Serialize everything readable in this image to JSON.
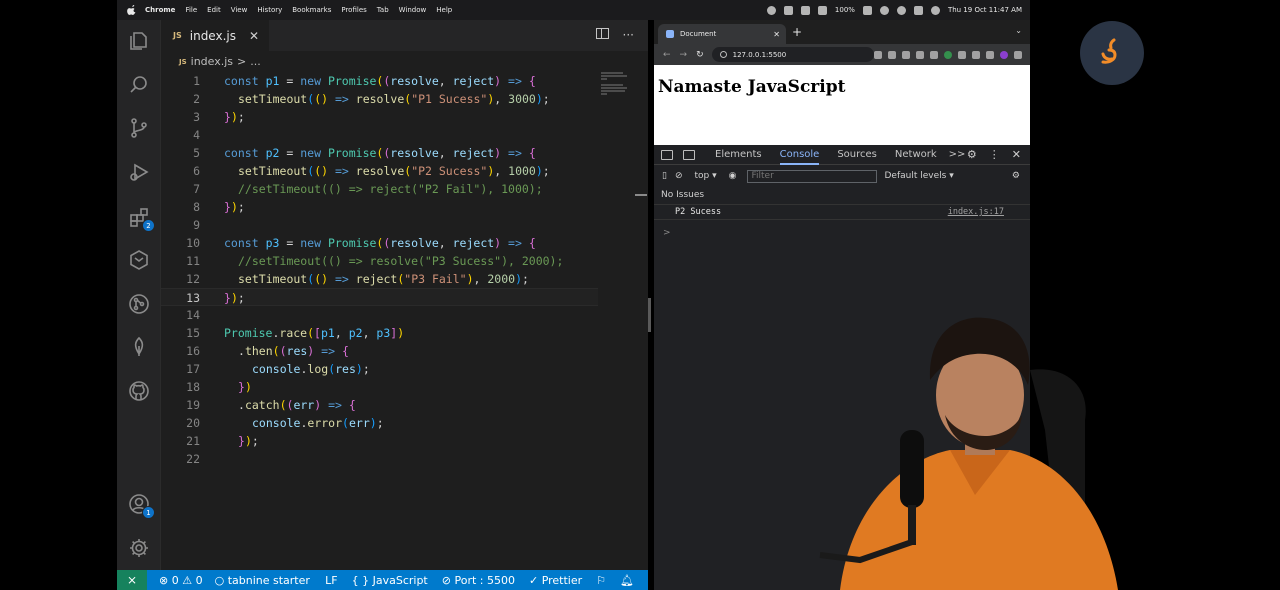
{
  "menubar": {
    "items": [
      "Chrome",
      "File",
      "Edit",
      "View",
      "History",
      "Bookmarks",
      "Profiles",
      "Tab",
      "Window",
      "Help"
    ],
    "battery": "100%",
    "datetime": "Thu 19 Oct  11:47 AM"
  },
  "vscode": {
    "tab": {
      "icon": "JS",
      "name": "index.js",
      "close": "✕"
    },
    "breadcrumb": {
      "icon": "JS",
      "file": "index.js",
      "sep": ">",
      "rest": "..."
    },
    "line_numbers": [
      "1",
      "2",
      "3",
      "4",
      "5",
      "6",
      "7",
      "8",
      "9",
      "10",
      "11",
      "12",
      "13",
      "14",
      "15",
      "16",
      "17",
      "18",
      "19",
      "20",
      "21",
      "22"
    ],
    "extensions_badge": "2",
    "account_badge": "1",
    "status": {
      "problems_errors": "0",
      "problems_warnings": "0",
      "tabnine": "tabnine starter",
      "eol": "LF",
      "language": "JavaScript",
      "port": "Port : 5500",
      "prettier": "Prettier"
    }
  },
  "code": [
    [
      "const",
      "p1",
      "=",
      "new",
      "Promise",
      "resolve",
      "reject",
      "=>"
    ],
    [
      "setTimeout",
      "=>",
      "resolve",
      "\"P1 Sucess\"",
      "3000"
    ],
    [],
    [],
    [
      "const",
      "p2",
      "=",
      "new",
      "Promise",
      "resolve",
      "reject",
      "=>"
    ],
    [
      "setTimeout",
      "=>",
      "resolve",
      "\"P2 Sucess\"",
      "1000"
    ],
    [
      "//setTimeout(() => reject(\"P2 Fail\"), 1000);"
    ],
    [],
    [],
    [
      "const",
      "p3",
      "=",
      "new",
      "Promise",
      "resolve",
      "reject",
      "=>"
    ],
    [
      "//setTimeout(() => resolve(\"P3 Sucess\"), 2000);"
    ],
    [
      "setTimeout",
      "=>",
      "reject",
      "\"P3 Fail\"",
      "2000"
    ],
    [],
    [],
    [
      "Promise",
      "race",
      "p1",
      "p2",
      "p3"
    ],
    [
      "then",
      "res",
      "=>"
    ],
    [
      "console",
      "log",
      "res"
    ],
    [],
    [
      "catch",
      "err",
      "=>"
    ],
    [
      "console",
      "error",
      "err"
    ],
    [],
    []
  ],
  "chrome": {
    "tab_title": "Document",
    "tab_close": "✕",
    "new_tab": "+",
    "url": "127.0.0.1:5500",
    "page_heading": "Namaste JavaScript",
    "devtools": {
      "tabs": [
        "Elements",
        "Console",
        "Sources",
        "Network"
      ],
      "active_tab": "Console",
      "more": ">>",
      "context": "top",
      "filter_placeholder": "Filter",
      "levels": "Default levels",
      "issues": "No Issues",
      "log_message": "P2 Sucess",
      "log_source": "index.js:17",
      "prompt": ">"
    }
  },
  "colors": {
    "editor_bg": "#1e1e1e",
    "statusbar": "#007acc",
    "remote": "#16825d",
    "devtools_bg": "#202124",
    "accent_blue": "#8ab4f8"
  }
}
